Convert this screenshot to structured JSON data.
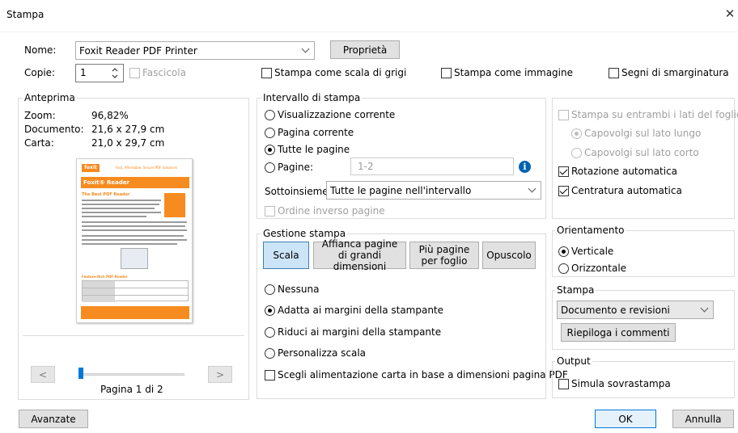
{
  "dialog": {
    "title": "Stampa",
    "close_glyph": "✕"
  },
  "printer": {
    "name_label": "Nome:",
    "name_value": "Foxit Reader PDF Printer",
    "properties_button": "Proprietà",
    "copies_label": "Copie:",
    "copies_value": "1",
    "collate_label": "Fascicola",
    "grayscale_label": "Stampa come scala di grigi",
    "as_image_label": "Stampa come immagine",
    "bleed_marks_label": "Segni di smarginatura"
  },
  "preview": {
    "group_label": "Anteprima",
    "zoom_label": "Zoom:",
    "zoom_value": "96,82%",
    "document_label": "Documento:",
    "document_value": "21,6 x 27,9 cm",
    "paper_label": "Carta:",
    "paper_value": "21,0 x 29,7 cm",
    "page_header_logo": "foxit",
    "page_header_tagline": "Fast, Affordable, Secure PDF Solutions",
    "page_title": "Foxit® Reader",
    "page_subtitle": "The Best PDF Reader",
    "page_table_title": "Feature-Rich PDF Reader",
    "prev_button": "<",
    "next_button": ">",
    "page_indicator": "Pagina 1 di 2",
    "slider_position": 0
  },
  "range": {
    "group_label": "Intervallo di stampa",
    "current_view": "Visualizzazione corrente",
    "current_page": "Pagina corrente",
    "all_pages": "Tutte le pagine",
    "pages": "Pagine:",
    "pages_placeholder": "1-2",
    "subset_label": "Sottoinsieme:",
    "subset_value": "Tutte le pagine nell'intervallo",
    "reverse_label": "Ordine inverso pagine"
  },
  "handling": {
    "group_label": "Gestione stampa",
    "tab_scale": "Scala",
    "tab_tile_line1": "Affianca pagine",
    "tab_tile_line2": "di grandi dimensioni",
    "tab_multi_line1": "Più pagine",
    "tab_multi_line2": "per foglio",
    "tab_booklet": "Opuscolo",
    "none": "Nessuna",
    "fit": "Adatta ai margini della stampante",
    "shrink": "Riduci ai margini della stampante",
    "custom": "Personalizza scala",
    "paper_source": "Scegli alimentazione carta in base a dimensioni pagina PDF"
  },
  "duplex": {
    "both_sides": "Stampa su entrambi i lati del foglio",
    "long_edge": "Capovolgi sul lato lungo",
    "short_edge": "Capovolgi sul lato corto",
    "auto_rotate": "Rotazione automatica",
    "auto_center": "Centratura automatica"
  },
  "orientation": {
    "group_label": "Orientamento",
    "portrait": "Verticale",
    "landscape": "Orizzontale"
  },
  "print_what": {
    "group_label": "Stampa",
    "value": "Documento e revisioni",
    "summarize_button": "Riepiloga i commenti"
  },
  "output": {
    "group_label": "Output",
    "simulate_overprint": "Simula sovrastampa"
  },
  "footer": {
    "advanced_button": "Avanzate",
    "ok_button": "OK",
    "cancel_button": "Annulla"
  },
  "colors": {
    "accent": "#0078d7",
    "selected_tab": "#cce4f7",
    "foxit_orange": "#f68b1f",
    "info_blue": "#0063b1"
  }
}
